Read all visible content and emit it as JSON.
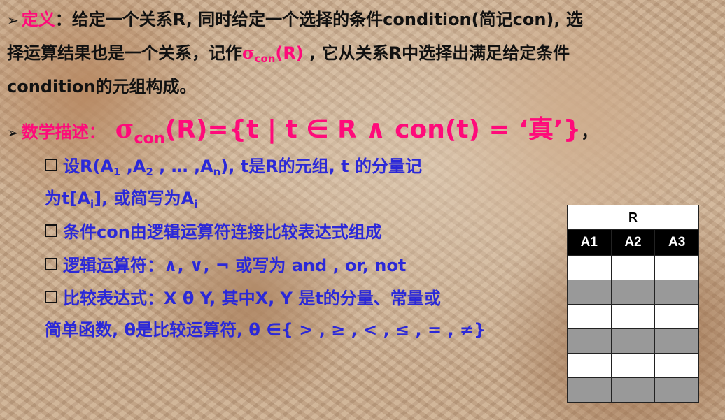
{
  "def": {
    "label": "定义",
    "colon": "：",
    "l1_text": "给定一个关系R, 同时给定一个选择的条件condition(简记con), 选",
    "l2_a": "择运算结果也是一个关系，记作",
    "l2_sigma": "σ",
    "l2_sub": "con",
    "l2_r": "(R)",
    "l2_b": " , 它从关系R中选择出满足给定条件",
    "l3_text": "condition的元组构成。"
  },
  "math": {
    "label": "数学描述",
    "colon": "：",
    "sigma": "σ",
    "sub": "con",
    "rest": "(R)={t | t ∈ R ∧ con(t) = ‘真’}",
    "trail": "，"
  },
  "items": {
    "i1_a": "设R(A",
    "i1_s1": "1",
    "i1_b": " ,A",
    "i1_s2": "2",
    "i1_c": " , … ,A",
    "i1_s3": "n",
    "i1_d": "), t是R的元组, t 的分量记",
    "i1_e": "为t[A",
    "i1_s4": "i",
    "i1_f": "], 或简写为A",
    "i1_s5": "i",
    "i2": "条件con由逻辑运算符连接比较表达式组成",
    "i3": "逻辑运算符：∧, ∨, ¬ 或写为 and , or, not",
    "i4_a": "比较表达式：X θ Y,  其中X, Y 是t的分量、常量或",
    "i4_b": "简单函数, θ是比较运算符, θ ∈{ > , ≥ , < , ≤ , = , ≠}"
  },
  "table": {
    "title": "R",
    "headers": [
      "A1",
      "A2",
      "A3"
    ],
    "row_colors": [
      "#ffffff",
      "#999999",
      "#ffffff",
      "#999999",
      "#ffffff",
      "#999999"
    ]
  },
  "colors": {
    "pink": "#ff0a7a",
    "blue": "#2b28d8",
    "black": "#111111"
  }
}
